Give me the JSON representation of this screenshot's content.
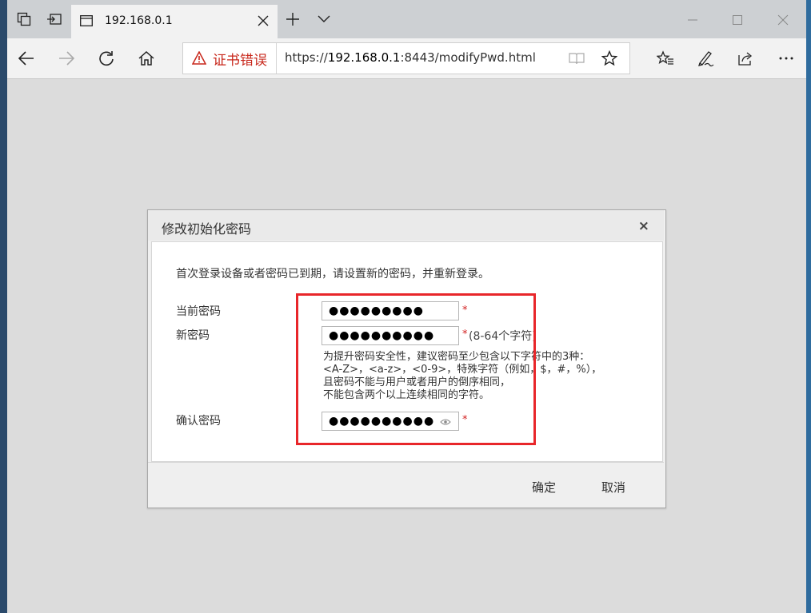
{
  "browser": {
    "tab_title": "192.168.0.1",
    "cert_error": "证书错误",
    "url_prefix": "https://",
    "url_host": "192.168.0.1",
    "url_rest": ":8443/modifyPwd.html"
  },
  "dialog": {
    "title": "修改初始化密码",
    "close": "×",
    "intro": "首次登录设备或者密码已到期，请设置新的密码，并重新登录。",
    "fields": {
      "current": {
        "label": "当前密码",
        "value": "●●●●●●●●●",
        "required": "*"
      },
      "new": {
        "label": "新密码",
        "value": "●●●●●●●●●●",
        "required": "*",
        "hint": "(8-64个字符)"
      },
      "confirm": {
        "label": "确认密码",
        "value": "●●●●●●●●●●",
        "required": "*"
      }
    },
    "tips": [
      "为提升密码安全性，建议密码至少包含以下字符中的3种：",
      "<A-Z>，<a-z>，<0-9>，特殊字符（例如，$，#，%），",
      "且密码不能与用户或者用户的倒序相同，",
      "不能包含两个以上连续相同的字符。"
    ],
    "ok": "确定",
    "cancel": "取消"
  },
  "colors": {
    "highlight_border": "#e8262a",
    "cert_error": "#c8271b",
    "required": "#d21f1f"
  },
  "icons": [
    "tab-set-aside-icon",
    "tab-preview-icon",
    "page-icon",
    "close-icon",
    "new-tab-icon",
    "chevron-down-icon",
    "minimize-icon",
    "maximize-icon",
    "window-close-icon",
    "back-icon",
    "forward-icon",
    "refresh-icon",
    "home-icon",
    "warning-icon",
    "reading-view-icon",
    "favorite-star-icon",
    "favorites-list-icon",
    "pen-icon",
    "share-icon",
    "more-icon",
    "eye-icon"
  ]
}
